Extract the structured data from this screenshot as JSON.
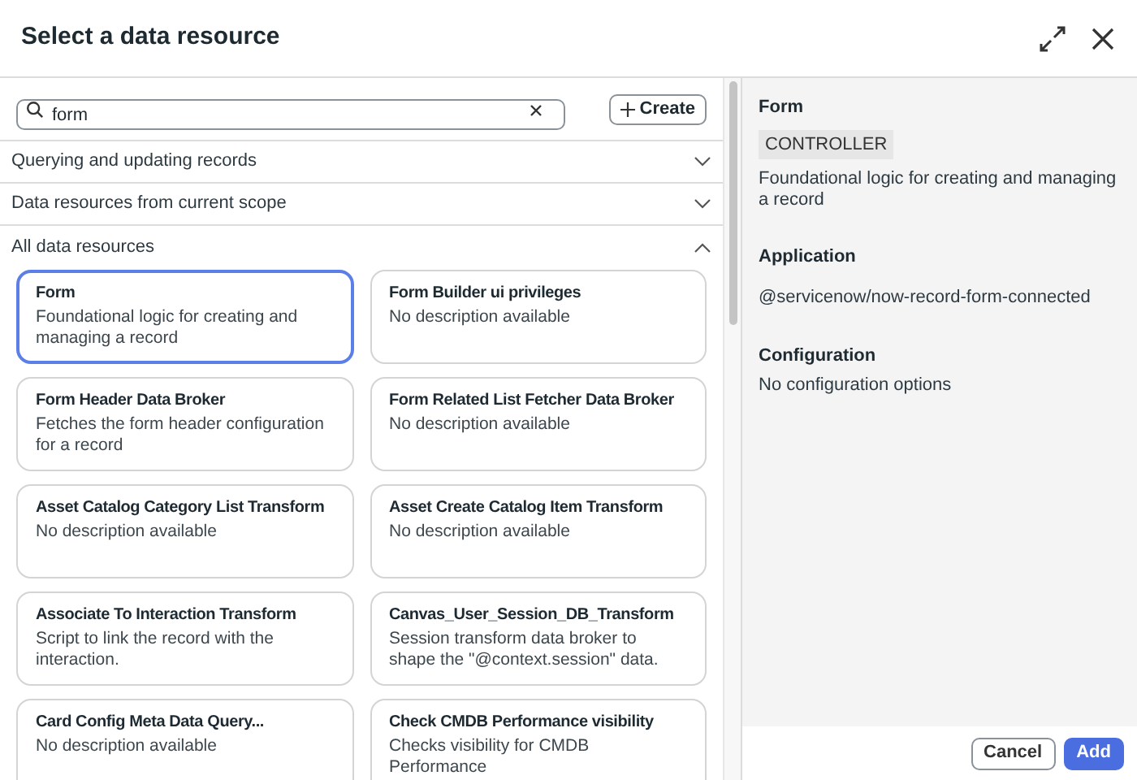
{
  "window": {
    "title": "Select a data resource"
  },
  "search": {
    "value": "form"
  },
  "create_button": {
    "label": "Create"
  },
  "sections": [
    {
      "label": "Querying and updating records",
      "expanded": false
    },
    {
      "label": "Data resources from current scope",
      "expanded": false
    },
    {
      "label": "All data resources",
      "expanded": true
    }
  ],
  "cards": [
    {
      "title": "Form",
      "description": "Foundational logic for creating and managing a record",
      "selected": true
    },
    {
      "title": "Form Builder ui privileges",
      "description": "No description available",
      "selected": false
    },
    {
      "title": "Form Header Data Broker",
      "description": "Fetches the form header configuration for a record",
      "selected": false
    },
    {
      "title": "Form Related List Fetcher Data Broker",
      "description": "No description available",
      "selected": false
    },
    {
      "title": "Asset Catalog Category List Transform",
      "description": "No description available",
      "selected": false
    },
    {
      "title": "Asset Create Catalog Item Transform",
      "description": "No description available",
      "selected": false
    },
    {
      "title": "Associate To Interaction Transform",
      "description": "Script to link the record with the interaction.",
      "selected": false
    },
    {
      "title": "Canvas_User_Session_DB_Transform",
      "description": "Session transform data broker to shape the \"@context.session\" data.",
      "selected": false
    },
    {
      "title": "Card Config Meta Data Query...",
      "description": "No description available",
      "selected": false
    },
    {
      "title": "Check CMDB Performance visibility",
      "description": "Checks visibility for CMDB Performance",
      "selected": false
    }
  ],
  "details": {
    "title": "Form",
    "badge": "CONTROLLER",
    "description": "Foundational logic for creating and managing a record",
    "sections": [
      {
        "heading": "Application",
        "text": "@servicenow/now-record-form-connected"
      },
      {
        "heading": "Configuration",
        "text": "No configuration options"
      }
    ]
  },
  "buttons": [
    {
      "label": "Cancel",
      "kind": "secondary"
    },
    {
      "label": "Add",
      "kind": "primary"
    }
  ]
}
